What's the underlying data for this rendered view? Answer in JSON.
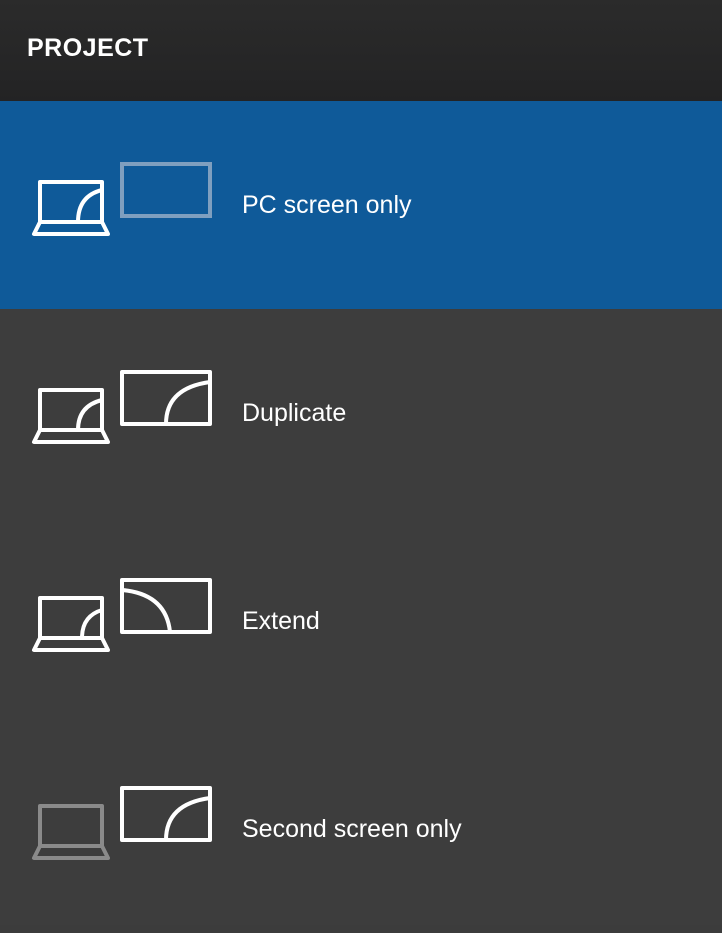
{
  "panel": {
    "title": "PROJECT"
  },
  "options": [
    {
      "label": "PC screen only",
      "icon": "pc-screen-only-icon",
      "selected": true
    },
    {
      "label": "Duplicate",
      "icon": "duplicate-icon",
      "selected": false
    },
    {
      "label": "Extend",
      "icon": "extend-icon",
      "selected": false
    },
    {
      "label": "Second screen only",
      "icon": "second-screen-only-icon",
      "selected": false
    }
  ],
  "colors": {
    "selected_background": "#0f5a99",
    "panel_background": "#3d3d3d",
    "header_background": "#262627",
    "icon_active": "#ffffff",
    "icon_dimmed_monitor": "#7f9fbf",
    "icon_dimmed_laptop": "#8a8a8a"
  }
}
